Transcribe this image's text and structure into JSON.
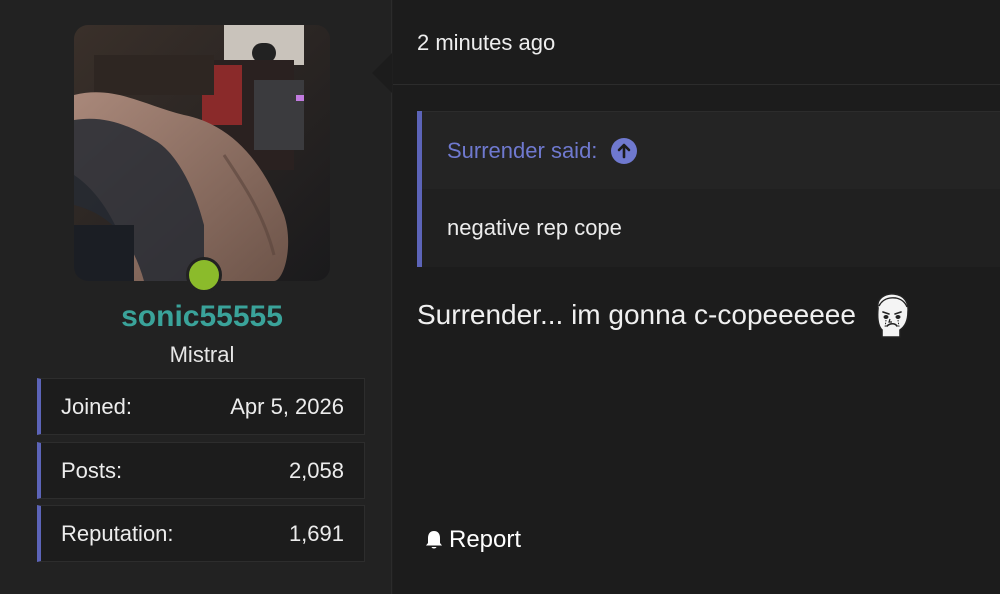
{
  "user": {
    "username": "sonic55555",
    "title": "Mistral",
    "online": true,
    "stats": [
      {
        "label": "Joined:",
        "value": "Apr 5, 2026"
      },
      {
        "label": "Posts:",
        "value": "2,058"
      },
      {
        "label": "Reputation:",
        "value": "1,691"
      }
    ]
  },
  "post": {
    "timestamp": "2 minutes ago",
    "quote": {
      "author_said": "Surrender said:",
      "text": "negative rep cope"
    },
    "message": "Surrender... im gonna c-copeeeeee",
    "report_label": "Report"
  },
  "colors": {
    "username": "#3aa39a",
    "accent": "#5c64b8",
    "quote_link": "#6f79cf",
    "online": "#8bbb2b"
  },
  "icons": {
    "quote_jump": "arrow-up-circle-icon",
    "report": "bell-icon",
    "emoji": "crying-wojak-emoji"
  }
}
